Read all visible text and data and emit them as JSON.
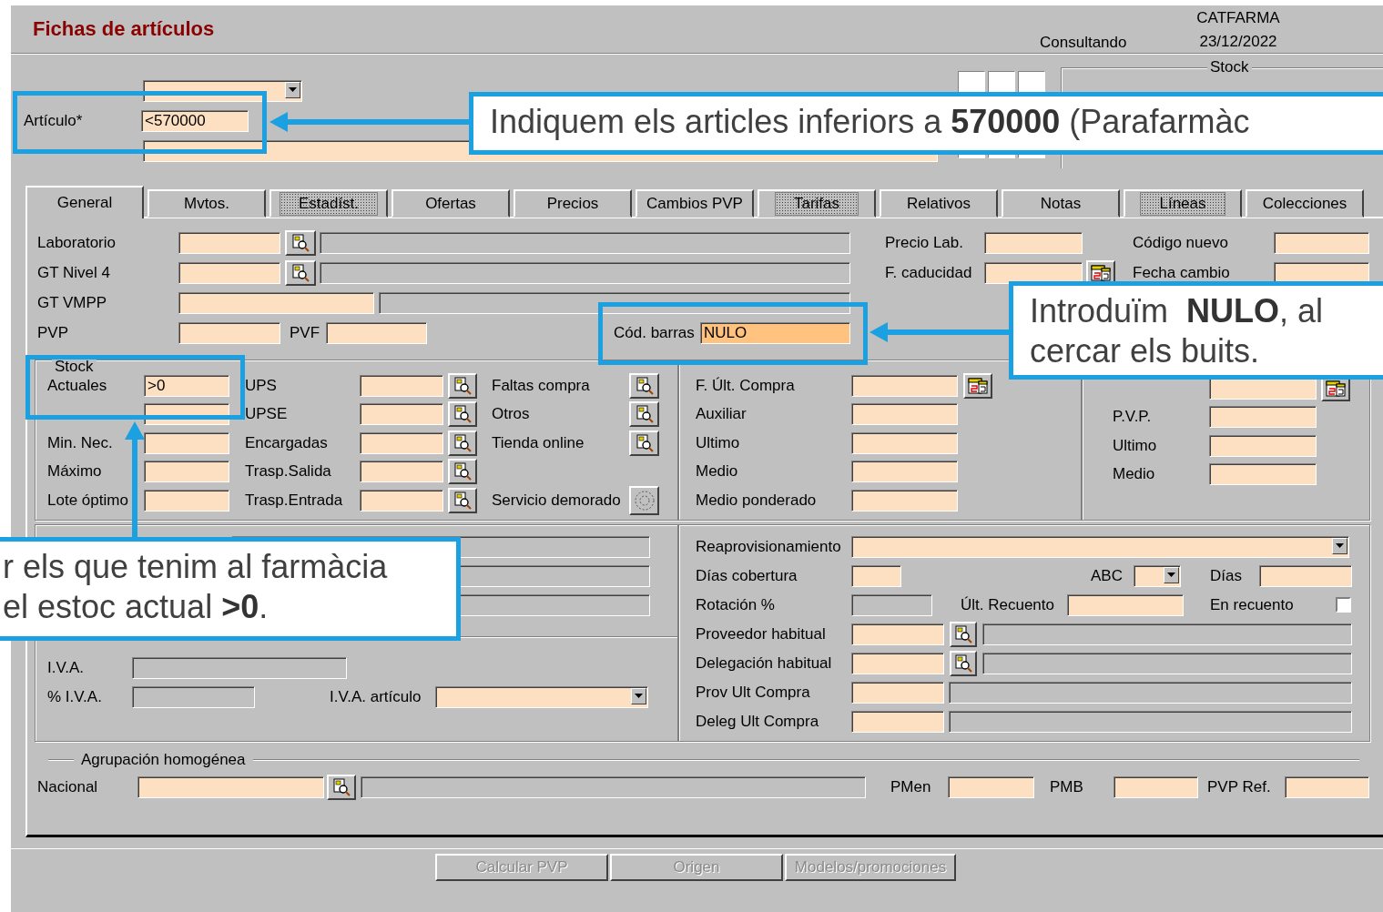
{
  "window": {
    "title": "Fichas de artículos",
    "mode": "Consultando",
    "company": "CATFARMA",
    "date": "23/12/2022"
  },
  "header": {
    "article": {
      "label": "Artículo*",
      "value": "<570000",
      "focused": false
    },
    "stock_title": "Stock"
  },
  "tabs": [
    {
      "label": "General",
      "selected": true,
      "disabled": false
    },
    {
      "label": "Mvtos.",
      "selected": false,
      "disabled": false
    },
    {
      "label": "Estadíst.",
      "selected": false,
      "disabled": true
    },
    {
      "label": "Ofertas",
      "selected": false,
      "disabled": false
    },
    {
      "label": "Precios",
      "selected": false,
      "disabled": false
    },
    {
      "label": "Cambios PVP",
      "selected": false,
      "disabled": false
    },
    {
      "label": "Tarifas",
      "selected": false,
      "disabled": true
    },
    {
      "label": "Relativos",
      "selected": false,
      "disabled": false
    },
    {
      "label": "Notas",
      "selected": false,
      "disabled": false
    },
    {
      "label": "Líneas",
      "selected": false,
      "disabled": true
    },
    {
      "label": "Colecciones",
      "selected": false,
      "disabled": false
    }
  ],
  "general": {
    "rows": [
      [
        {
          "kind": "label",
          "text": "Laboratorio"
        },
        {
          "kind": "field"
        },
        {
          "kind": "lookup"
        },
        {
          "kind": "readonly"
        },
        {
          "kind": "label",
          "text": "Precio Lab."
        },
        {
          "kind": "field"
        },
        {
          "kind": "label",
          "text": "Código nuevo"
        },
        {
          "kind": "field"
        }
      ],
      [
        {
          "kind": "label",
          "text": "GT Nivel 4"
        },
        {
          "kind": "field"
        },
        {
          "kind": "lookup"
        },
        {
          "kind": "readonly"
        },
        {
          "kind": "label",
          "text": "F. caducidad"
        },
        {
          "kind": "field"
        },
        {
          "kind": "calendar"
        },
        {
          "kind": "label",
          "text": "Fecha cambio"
        },
        {
          "kind": "field"
        }
      ],
      [
        {
          "kind": "label",
          "text": "GT VMPP"
        },
        {
          "kind": "field"
        },
        {
          "kind": "readonly"
        }
      ],
      [
        {
          "kind": "label",
          "text": "PVP"
        },
        {
          "kind": "field"
        },
        {
          "kind": "label",
          "text": "PVF"
        },
        {
          "kind": "field"
        },
        {
          "kind": "label",
          "text": "Cód. barras"
        },
        {
          "kind": "field",
          "value": "NULO",
          "focused": true
        }
      ]
    ],
    "stock": {
      "title": "Stock",
      "rows": [
        [
          {
            "kind": "label",
            "text": "Actuales"
          },
          {
            "kind": "field",
            "value": ">0",
            "focused": false
          },
          {
            "kind": "label",
            "text": "UPS"
          },
          {
            "kind": "field"
          },
          {
            "kind": "lookup"
          },
          {
            "kind": "label",
            "text": "Faltas compra"
          },
          {
            "kind": "lookup"
          }
        ],
        [
          {
            "kind": "label",
            "text": ""
          },
          {
            "kind": "field"
          },
          {
            "kind": "label",
            "text": "UPSE"
          },
          {
            "kind": "field"
          },
          {
            "kind": "lookup"
          },
          {
            "kind": "label",
            "text": "Otros"
          },
          {
            "kind": "lookup"
          }
        ],
        [
          {
            "kind": "label",
            "text": "Min. Nec."
          },
          {
            "kind": "field"
          },
          {
            "kind": "label",
            "text": "Encargadas"
          },
          {
            "kind": "field"
          },
          {
            "kind": "lookup"
          },
          {
            "kind": "label",
            "text": "Tienda online"
          },
          {
            "kind": "lookup"
          }
        ],
        [
          {
            "kind": "label",
            "text": "Máximo"
          },
          {
            "kind": "field"
          },
          {
            "kind": "label",
            "text": "Trasp.Salida"
          },
          {
            "kind": "field"
          },
          {
            "kind": "lookup"
          }
        ],
        [
          {
            "kind": "label",
            "text": "Lote óptimo"
          },
          {
            "kind": "field"
          },
          {
            "kind": "label",
            "text": "Trasp.Entrada"
          },
          {
            "kind": "field"
          },
          {
            "kind": "lookup"
          },
          {
            "kind": "label",
            "text": "Servicio demorado"
          },
          {
            "kind": "gear"
          }
        ]
      ]
    },
    "purchase_prices": {
      "rows": [
        [
          {
            "kind": "label",
            "text": "F. Últ. Compra"
          },
          {
            "kind": "field"
          },
          {
            "kind": "calendar"
          }
        ],
        [
          {
            "kind": "label",
            "text": "Auxiliar"
          },
          {
            "kind": "field"
          }
        ],
        [
          {
            "kind": "label",
            "text": "Ultimo"
          },
          {
            "kind": "field"
          }
        ],
        [
          {
            "kind": "label",
            "text": "Medio"
          },
          {
            "kind": "field"
          }
        ],
        [
          {
            "kind": "label",
            "text": "Medio ponderado"
          },
          {
            "kind": "field"
          }
        ]
      ]
    },
    "sale_prices": {
      "rows": [
        [
          {
            "kind": "field"
          },
          {
            "kind": "calendar"
          }
        ],
        [
          {
            "kind": "label",
            "text": "P.V.P."
          },
          {
            "kind": "field"
          }
        ],
        [
          {
            "kind": "label",
            "text": "Ultimo"
          },
          {
            "kind": "field"
          }
        ],
        [
          {
            "kind": "label",
            "text": "Medio"
          },
          {
            "kind": "field"
          }
        ]
      ]
    },
    "taxes": {
      "rows": [
        [
          {
            "kind": "readonly"
          }
        ],
        [
          {
            "kind": "readonly"
          }
        ],
        [
          {
            "kind": "readonly"
          }
        ],
        [
          {
            "kind": "label",
            "text": "I.V.A."
          },
          {
            "kind": "readonly"
          }
        ],
        [
          {
            "kind": "label",
            "text": "% I.V.A."
          },
          {
            "kind": "readonly"
          },
          {
            "kind": "label",
            "text": "I.V.A. artículo"
          },
          {
            "kind": "dropdown"
          }
        ]
      ]
    },
    "replenishment": {
      "rows": [
        [
          {
            "kind": "label",
            "text": "Reaprovisionamiento"
          },
          {
            "kind": "dropdown"
          }
        ],
        [
          {
            "kind": "label",
            "text": "Días cobertura"
          },
          {
            "kind": "field"
          },
          {
            "kind": "label",
            "text": "ABC"
          },
          {
            "kind": "dropdown"
          },
          {
            "kind": "label",
            "text": "Días"
          },
          {
            "kind": "field"
          }
        ],
        [
          {
            "kind": "label",
            "text": "Rotación %"
          },
          {
            "kind": "readonly"
          },
          {
            "kind": "label",
            "text": "Últ. Recuento"
          },
          {
            "kind": "field"
          },
          {
            "kind": "label",
            "text": "En recuento"
          },
          {
            "kind": "checkbox",
            "checked": false
          }
        ],
        [
          {
            "kind": "label",
            "text": "Proveedor habitual"
          },
          {
            "kind": "field"
          },
          {
            "kind": "lookup"
          },
          {
            "kind": "readonly"
          }
        ],
        [
          {
            "kind": "label",
            "text": "Delegación habitual"
          },
          {
            "kind": "field"
          },
          {
            "kind": "lookup"
          },
          {
            "kind": "readonly"
          }
        ],
        [
          {
            "kind": "label",
            "text": "Prov Ult Compra"
          },
          {
            "kind": "field"
          },
          {
            "kind": "readonly"
          }
        ],
        [
          {
            "kind": "label",
            "text": "Deleg Ult Compra"
          },
          {
            "kind": "field"
          },
          {
            "kind": "readonly"
          }
        ]
      ]
    },
    "homogeneous_group": {
      "title": "Agrupación homogénea",
      "rows": [
        [
          {
            "kind": "label",
            "text": "Nacional"
          },
          {
            "kind": "field"
          },
          {
            "kind": "lookup"
          },
          {
            "kind": "readonly"
          },
          {
            "kind": "label",
            "text": "PMen"
          },
          {
            "kind": "field"
          },
          {
            "kind": "label",
            "text": "PMB"
          },
          {
            "kind": "field"
          },
          {
            "kind": "label",
            "text": "PVP Ref."
          },
          {
            "kind": "field"
          }
        ]
      ]
    }
  },
  "buttons": [
    {
      "label": "Calcular PVP",
      "disabled": true
    },
    {
      "label": "Origen",
      "disabled": true
    },
    {
      "label": "Modelos/promociones",
      "disabled": true
    }
  ],
  "callouts": [
    {
      "text": "Indiquem els articles inferiors a **570000** (Parafarmàc"
    },
    {
      "text": "Introduïm  **NULO**, al\ncercar els buits."
    },
    {
      "text": "r els que tenim al farmàcia\nel estoc actual **>0**."
    }
  ]
}
